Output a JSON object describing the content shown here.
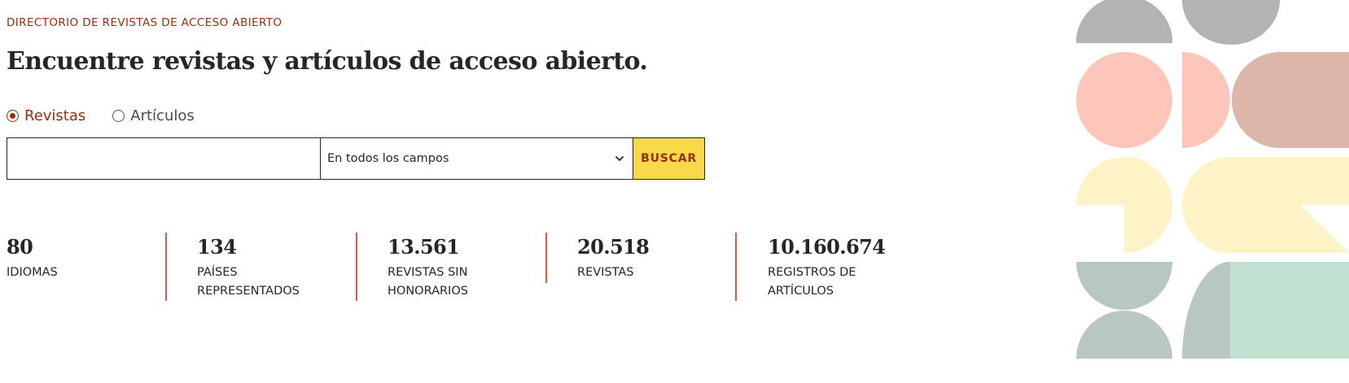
{
  "header": {
    "eyebrow": "DIRECTORIO DE REVISTAS DE ACCESO ABIERTO",
    "title": "Encuentre revistas y artículos de acceso abierto."
  },
  "search": {
    "options": [
      {
        "label": "Revistas",
        "selected": true
      },
      {
        "label": "Artículos",
        "selected": false
      }
    ],
    "query_value": "",
    "field_select": "En todos los campos",
    "button_label": "BUSCAR"
  },
  "stats": [
    {
      "value": "80",
      "label": "IDIOMAS"
    },
    {
      "value": "134",
      "label": "PAÍSES REPRESENTADOS"
    },
    {
      "value": "13.561",
      "label": "REVISTAS SIN HONORARIOS"
    },
    {
      "value": "20.518",
      "label": "REVISTAS"
    },
    {
      "value": "10.160.674",
      "label": "REGISTROS DE ARTÍCULOS"
    }
  ],
  "colors": {
    "accent": "#982e0c",
    "button_bg": "#f9d84a",
    "divider": "#e0564a",
    "text": "#282624",
    "pattern_gray": "#b3b3b3",
    "pattern_pink": "#fec6bb",
    "pattern_tan": "#dcb6a8",
    "pattern_cream": "#fdf3c6",
    "pattern_slate": "#b8c6c4",
    "pattern_mint": "#c0e0d2"
  },
  "icons": {
    "select_chevron": "chevron-down-icon"
  }
}
